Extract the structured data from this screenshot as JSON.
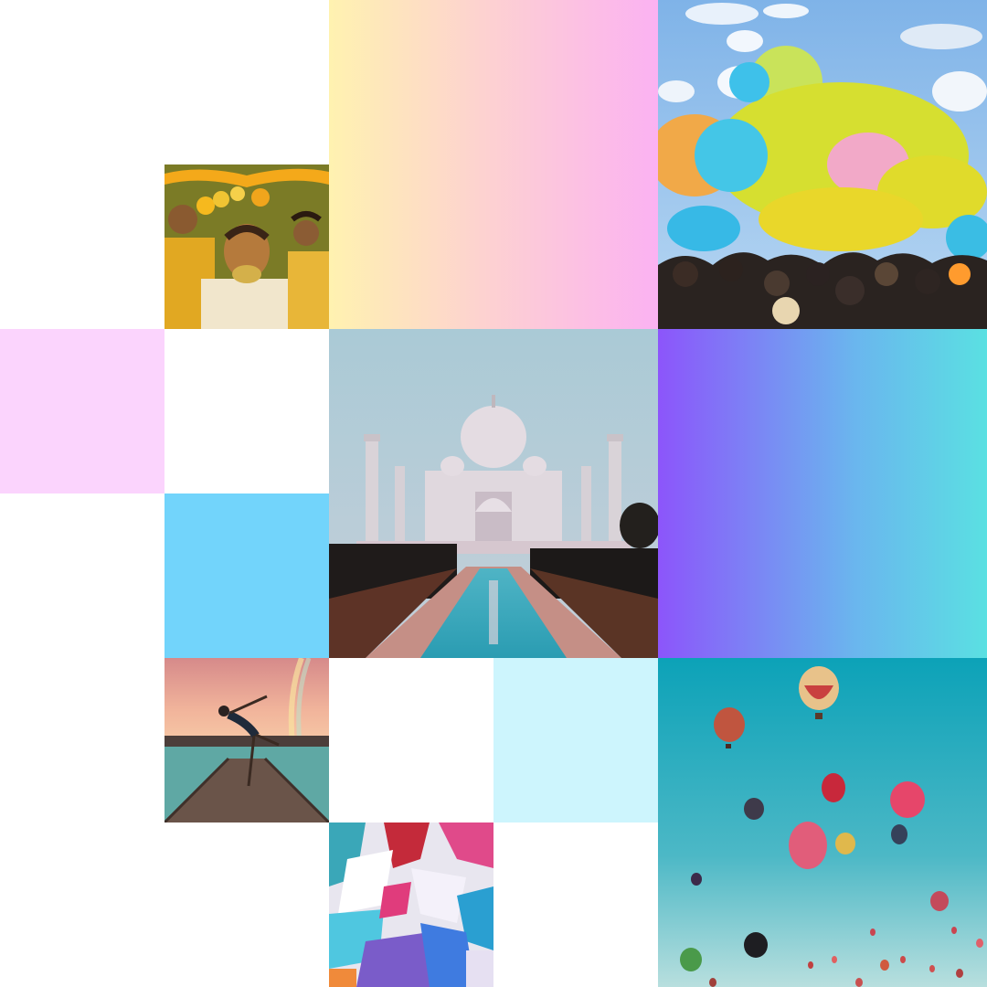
{
  "collage": {
    "tiles": [
      {
        "name": "gradient-top",
        "kind": "gradient",
        "colors": [
          "#fff2b0",
          "#fdd3cf",
          "#fbb2f2"
        ]
      },
      {
        "name": "holi-crowd-photo",
        "kind": "photo"
      },
      {
        "name": "haldi-ceremony-photo",
        "kind": "photo"
      },
      {
        "name": "pink-block",
        "kind": "solid",
        "color": "#fbd4fd"
      },
      {
        "name": "taj-mahal-photo",
        "kind": "photo"
      },
      {
        "name": "gradient-right",
        "kind": "gradient",
        "colors": [
          "#8c55fb",
          "#6ab6ee",
          "#5ae0e2"
        ]
      },
      {
        "name": "blue-block",
        "kind": "solid",
        "color": "#72d4fb"
      },
      {
        "name": "dancer-pier-photo",
        "kind": "photo"
      },
      {
        "name": "light-cyan-block",
        "kind": "solid",
        "color": "#cdf5fd"
      },
      {
        "name": "hot-air-balloons-photo",
        "kind": "photo"
      },
      {
        "name": "abstract-paint-photo",
        "kind": "photo"
      }
    ]
  }
}
